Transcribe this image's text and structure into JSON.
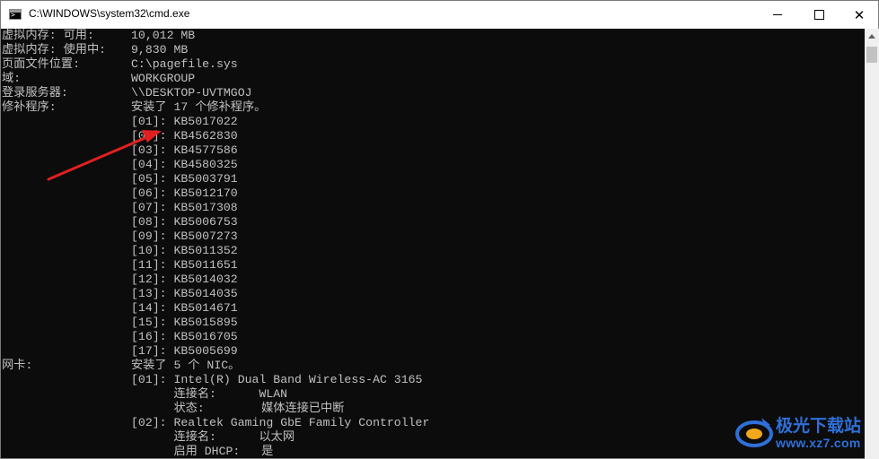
{
  "window": {
    "title": "C:\\WINDOWS\\system32\\cmd.exe",
    "icon": "cmd-icon",
    "controls": [
      "minimize-icon",
      "maximize-icon",
      "close-icon"
    ]
  },
  "console": {
    "rows": [
      {
        "label": "虚拟内存: 可用:",
        "value": "10,012 MB"
      },
      {
        "label": "虚拟内存: 使用中:",
        "value": "9,830 MB"
      },
      {
        "label": "页面文件位置:",
        "value": "C:\\pagefile.sys"
      },
      {
        "label": "域:",
        "value": "WORKGROUP"
      },
      {
        "label": "登录服务器:",
        "value": "\\\\DESKTOP-UVTMGOJ"
      },
      {
        "label": "修补程序:",
        "value": "安装了 17 个修补程序。"
      },
      {
        "label": "",
        "value": "[01]: KB5017022"
      },
      {
        "label": "",
        "value": "[02]: KB4562830"
      },
      {
        "label": "",
        "value": "[03]: KB4577586"
      },
      {
        "label": "",
        "value": "[04]: KB4580325"
      },
      {
        "label": "",
        "value": "[05]: KB5003791"
      },
      {
        "label": "",
        "value": "[06]: KB5012170"
      },
      {
        "label": "",
        "value": "[07]: KB5017308"
      },
      {
        "label": "",
        "value": "[08]: KB5006753"
      },
      {
        "label": "",
        "value": "[09]: KB5007273"
      },
      {
        "label": "",
        "value": "[10]: KB5011352"
      },
      {
        "label": "",
        "value": "[11]: KB5011651"
      },
      {
        "label": "",
        "value": "[12]: KB5014032"
      },
      {
        "label": "",
        "value": "[13]: KB5014035"
      },
      {
        "label": "",
        "value": "[14]: KB5014671"
      },
      {
        "label": "",
        "value": "[15]: KB5015895"
      },
      {
        "label": "",
        "value": "[16]: KB5016705"
      },
      {
        "label": "",
        "value": "[17]: KB5005699"
      },
      {
        "label": "网卡:",
        "value": "安装了 5 个 NIC。"
      },
      {
        "label": "",
        "value": "[01]: Intel(R) Dual Band Wireless-AC 3165"
      },
      {
        "label": "",
        "value": "      连接名:      WLAN"
      },
      {
        "label": "",
        "value": "      状态:        媒体连接已中断"
      },
      {
        "label": "",
        "value": "[02]: Realtek Gaming GbE Family Controller"
      },
      {
        "label": "",
        "value": "      连接名:      以太网"
      },
      {
        "label": "",
        "value": "      启用 DHCP:   是"
      }
    ]
  },
  "colors": {
    "console_background": "#0c0c0c",
    "console_text": "#c0c0c0",
    "annotation_arrow": "#e02020",
    "watermark": "#2f6fd8"
  },
  "watermark": {
    "title": "极光下载站",
    "url": "www.xz7.com"
  }
}
